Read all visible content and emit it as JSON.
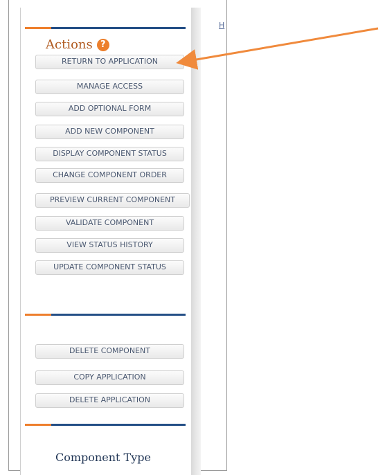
{
  "top_link": "H",
  "actions": {
    "title": "Actions",
    "help_icon": "question-mark"
  },
  "buttons_primary": [
    "RETURN TO APPLICATION",
    "MANAGE ACCESS",
    "ADD OPTIONAL FORM",
    "ADD NEW COMPONENT",
    "DISPLAY COMPONENT STATUS",
    "CHANGE COMPONENT ORDER",
    "PREVIEW CURRENT COMPONENT",
    "VALIDATE COMPONENT",
    "VIEW STATUS HISTORY",
    "UPDATE COMPONENT STATUS"
  ],
  "buttons_secondary": [
    "DELETE COMPONENT",
    "COPY APPLICATION",
    "DELETE APPLICATION"
  ],
  "component_type": {
    "title": "Component Type"
  },
  "annotation": {
    "arrow_color": "#f08a3c",
    "target": "RETURN TO APPLICATION"
  },
  "colors": {
    "accent_orange": "#ee7f2d",
    "accent_navy": "#244f86"
  }
}
